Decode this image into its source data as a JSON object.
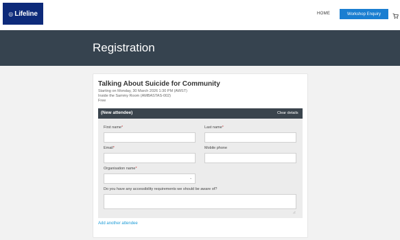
{
  "header": {
    "logo_text": "Lifeline",
    "nav_home": "HOME",
    "enquiry_button": "Workshop Enquiry",
    "cart_icon": "cart-icon"
  },
  "banner": {
    "title": "Registration"
  },
  "event": {
    "title": "Talking About Suicide for Community",
    "starting": "Starting on Monday, 30 March 2026 1:30 PM (AWST)",
    "location": "Inside the Sammy Room (AMBASTAS-002)",
    "price": "Free"
  },
  "attendee": {
    "header": "(New attendee)",
    "clear": "Clear details",
    "first_name_label": "First name",
    "last_name_label": "Last name",
    "email_label": "Email",
    "mobile_label": "Mobile phone",
    "org_label": "Organisation name",
    "access_label": "Do you have any accessibility requirements we should be aware of?",
    "required_mark": "*"
  },
  "add_attendee": "Add another attendee"
}
